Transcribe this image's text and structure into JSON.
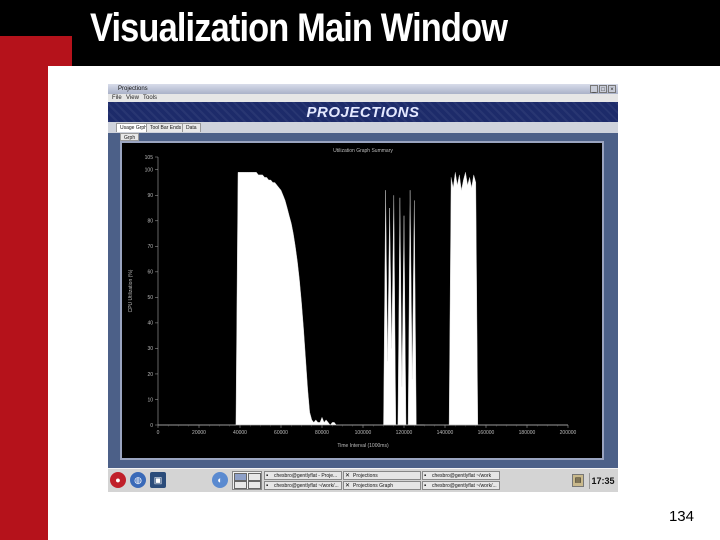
{
  "slide": {
    "title": "Visualization Main Window",
    "page_number": "134"
  },
  "window": {
    "title": "Projections",
    "controls": [
      "_",
      "□",
      "×"
    ],
    "menu": [
      "File",
      "View",
      "Tools"
    ],
    "banner": "PROJECTIONS",
    "tabs": [
      "Usage Grph",
      "Tool Bar Ends",
      "Data"
    ],
    "subtab": "Grph"
  },
  "chart_data": {
    "type": "area",
    "title": "Utilization Graph Summary",
    "xlabel": "Time Interval (1000ms)",
    "ylabel": "CPU Utilization (%)",
    "ylim": [
      0,
      105
    ],
    "yticks": [
      "0",
      "10",
      "20",
      "30",
      "40",
      "50",
      "60",
      "70",
      "80",
      "90",
      "100",
      "105"
    ],
    "xticks": [
      "0",
      "20000",
      "40000",
      "60000",
      "80000",
      "100000",
      "120000",
      "140000",
      "160000",
      "180000",
      "200000"
    ],
    "xlim": [
      0,
      200000
    ],
    "series": [
      {
        "x": [
          0,
          1000,
          2000,
          3000,
          4000,
          5000,
          6000,
          7000,
          8000,
          9000,
          10000,
          11000,
          12000,
          13000,
          14000,
          15000,
          16000,
          17000,
          18000,
          19000,
          20000,
          21000,
          22000,
          23000,
          24000,
          25000,
          26000,
          27000,
          28000,
          29000,
          30000,
          31000,
          32000,
          33000,
          34000,
          35000,
          36000,
          37000,
          38000,
          39000,
          40000,
          41000,
          42000,
          43000,
          44000,
          45000,
          46000,
          47000,
          48000,
          49000,
          50000,
          51000,
          52000,
          53000,
          54000,
          55000,
          56000,
          57000,
          58000,
          59000,
          60000,
          61000,
          62000,
          63000,
          64000,
          65000,
          66000,
          67000,
          68000,
          69000,
          70000,
          71000,
          72000,
          73000,
          74000,
          75000,
          76000,
          77000,
          78000,
          79000,
          80000,
          81000,
          82000,
          83000,
          84000,
          85000,
          86000,
          87000,
          88000,
          89000,
          90000,
          91000,
          92000,
          93000,
          94000,
          95000,
          96000,
          97000,
          98000,
          99000,
          100000,
          101000,
          102000,
          103000,
          104000,
          105000,
          106000,
          107000,
          108000,
          109000,
          110000,
          111000,
          112000,
          113000,
          114000,
          115000,
          116000,
          117000,
          118000,
          119000,
          120000,
          121000,
          122000,
          123000,
          124000,
          125000,
          126000,
          127000,
          128000,
          129000,
          130000,
          131000,
          132000,
          133000,
          134000,
          135000,
          136000,
          137000,
          138000,
          139000,
          140000,
          141000,
          142000,
          143000,
          144000,
          145000,
          146000,
          147000,
          148000,
          149000,
          150000,
          151000,
          152000,
          153000,
          154000,
          155000,
          156000,
          157000,
          158000,
          159000,
          160000,
          161000,
          162000,
          163000,
          164000,
          165000,
          166000,
          167000,
          168000,
          169000,
          170000,
          171000,
          172000,
          173000,
          174000,
          175000,
          176000,
          177000,
          178000,
          179000,
          180000,
          181000,
          182000,
          183000,
          184000,
          185000,
          186000,
          187000,
          188000,
          189000,
          190000,
          191000,
          192000,
          193000,
          194000,
          195000,
          196000,
          197000,
          198000,
          199000,
          200000
        ],
        "y": [
          0,
          0,
          0,
          0,
          0,
          0,
          0,
          0,
          0,
          0,
          0,
          0,
          0,
          0,
          0,
          0,
          0,
          0,
          0,
          0,
          0,
          0,
          0,
          0,
          0,
          0,
          0,
          0,
          0,
          0,
          0,
          0,
          0,
          0,
          0,
          0,
          0,
          0,
          0,
          99,
          99,
          99,
          99,
          99,
          99,
          99,
          99,
          99,
          99,
          98,
          98,
          98,
          97,
          97,
          96,
          96,
          95,
          95,
          94,
          93,
          92,
          90,
          88,
          85,
          82,
          79,
          75,
          70,
          64,
          57,
          48,
          38,
          26,
          14,
          5,
          2,
          1,
          2,
          1,
          1,
          3,
          1,
          2,
          1,
          0,
          1,
          1,
          0,
          0,
          0,
          0,
          0,
          0,
          0,
          0,
          0,
          0,
          0,
          0,
          0,
          0,
          0,
          0,
          0,
          0,
          0,
          0,
          0,
          0,
          0,
          0,
          0,
          0,
          0,
          0,
          0,
          0,
          0,
          0,
          0,
          0,
          0,
          0,
          0,
          0,
          0,
          0,
          0,
          0,
          0,
          0,
          0,
          0,
          0,
          0,
          0,
          0,
          0,
          0,
          0,
          0,
          0,
          0,
          0,
          0,
          0,
          0,
          0,
          0,
          0,
          0,
          0,
          0,
          0,
          0,
          0,
          0,
          0,
          0,
          0,
          0,
          0,
          0,
          0,
          0,
          0,
          0,
          0,
          0,
          0,
          0,
          0,
          0,
          0,
          0,
          0,
          0,
          0,
          0,
          0,
          0,
          0,
          0,
          0,
          0,
          0,
          0,
          0,
          0,
          0,
          0,
          0,
          0,
          0,
          0,
          0,
          0,
          0,
          0,
          0,
          0
        ]
      },
      {
        "x": [
          110000,
          111000,
          112000,
          113000,
          114000,
          115000,
          116000,
          117000,
          118000,
          119000,
          120000,
          121000,
          122000,
          123000,
          124000,
          125000,
          126000,
          127000,
          128000,
          129000,
          130000
        ],
        "y": [
          0,
          92,
          25,
          85,
          30,
          90,
          0,
          0,
          89,
          15,
          82,
          0,
          0,
          92,
          18,
          88,
          0,
          0,
          0,
          0,
          0
        ]
      },
      {
        "x": [
          142000,
          143000,
          144000,
          145000,
          146000,
          147000,
          148000,
          149000,
          150000,
          151000,
          152000,
          153000,
          154000,
          155000,
          156000
        ],
        "y": [
          0,
          97,
          93,
          99,
          94,
          98,
          92,
          96,
          99,
          94,
          97,
          93,
          98,
          95,
          0
        ]
      }
    ],
    "grid": false
  },
  "taskbar": {
    "tasks": [
      "chesbro@gentlyflat - Proje...",
      "Projections",
      "chesbro@gentlyflat ~/work/...",
      "Projections Graph",
      "chesbro@gentlyflat ~/work",
      "chesbro@gentlyflat ~/work/..."
    ],
    "clock": "17:35"
  },
  "colors": {
    "slide_red": "#b5121b",
    "banner_blue": "#1d2b6a",
    "chart_bg": "#000000",
    "chart_fill": "#ffffff"
  }
}
